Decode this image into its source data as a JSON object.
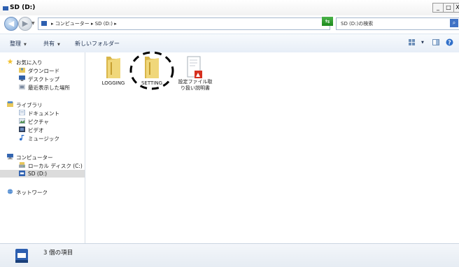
{
  "window": {
    "title": "SD (D:)",
    "min_button": "_",
    "max_button": "□",
    "close_button": "X"
  },
  "address": {
    "breadcrumb": "▸ コンピューター ▸ SD (D:) ▸",
    "refresh_icon": "⇆",
    "search_placeholder": "SD (D:)の検索",
    "search_icon": "⌕"
  },
  "nav_buttons": {
    "back": "◀",
    "forward": "▶"
  },
  "toolbar": {
    "organize": "整理",
    "share": "共有",
    "new_folder": "新しいフォルダー",
    "help": "?"
  },
  "sidebar": {
    "favorites": {
      "header": "お気に入り",
      "items": [
        "ダウンロード",
        "デスクトップ",
        "最近表示した場所"
      ]
    },
    "libraries": {
      "header": "ライブラリ",
      "items": [
        "ドキュメント",
        "ピクチャ",
        "ビデオ",
        "ミュージック"
      ]
    },
    "computer": {
      "header": "コンピューター",
      "items": [
        "ローカル ディスク (C:)",
        "SD (D:)"
      ]
    },
    "network": {
      "header": "ネットワーク"
    }
  },
  "files": [
    {
      "name": "LOGGING",
      "type": "folder"
    },
    {
      "name": "SETTING",
      "type": "folder",
      "highlighted": true
    },
    {
      "name": "設定ファイル取り扱い説明書",
      "type": "pdf"
    }
  ],
  "status": {
    "count_text": "3 個の項目"
  },
  "colors": {
    "accent": "#2d5fb0",
    "folder": "#e8c75a",
    "pdf_red": "#d6301f"
  }
}
